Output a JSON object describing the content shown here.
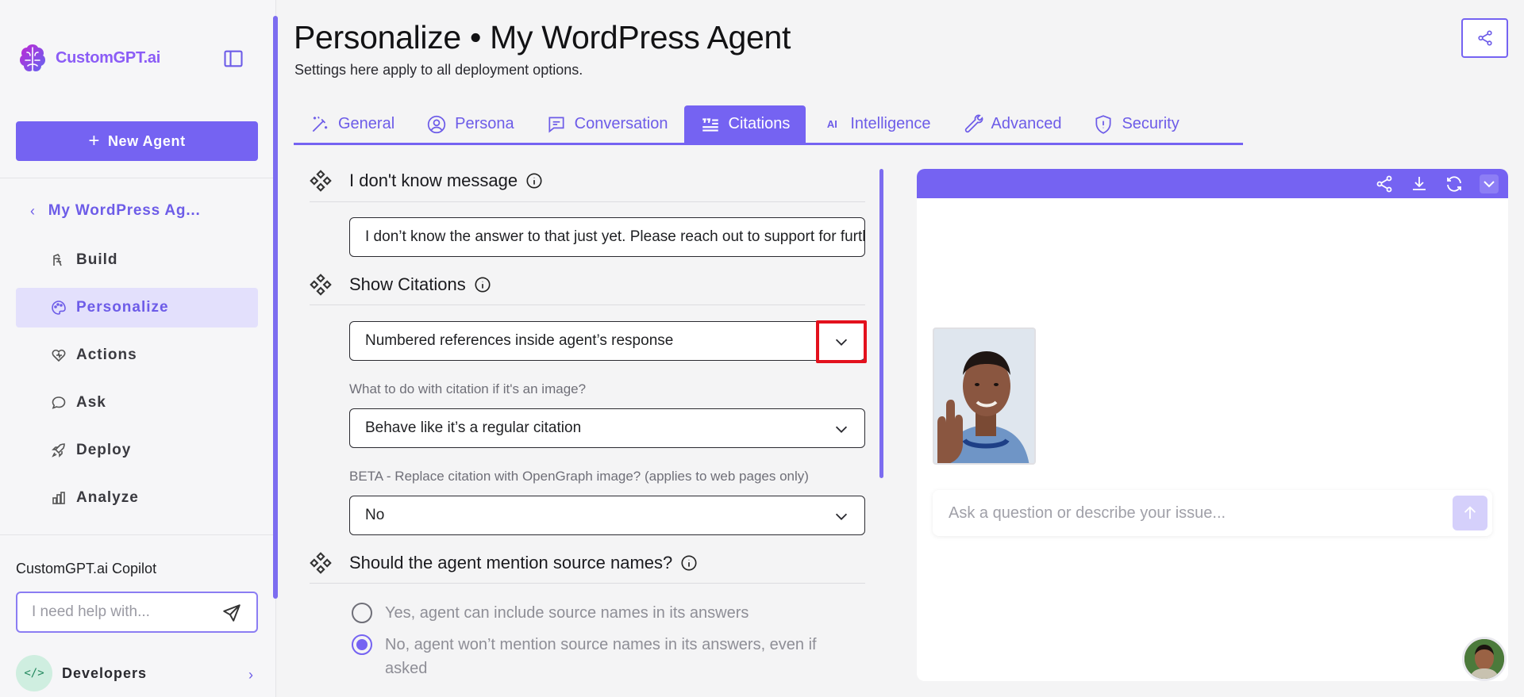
{
  "brand": {
    "name": "CustomGPT.ai",
    "accent": "#7563f2",
    "highlight": "#e3111d"
  },
  "sidebar": {
    "new_agent_label": "New Agent",
    "agent_name": "My WordPress Ag...",
    "items": [
      {
        "label": "Build",
        "icon": "build-icon"
      },
      {
        "label": "Personalize",
        "icon": "palette-icon",
        "active": true
      },
      {
        "label": "Actions",
        "icon": "actions-icon"
      },
      {
        "label": "Ask",
        "icon": "chat-icon"
      },
      {
        "label": "Deploy",
        "icon": "rocket-icon"
      },
      {
        "label": "Analyze",
        "icon": "chart-icon"
      }
    ],
    "copilot": {
      "title": "CustomGPT.ai Copilot",
      "placeholder": "I need help with..."
    },
    "developers_label": "Developers"
  },
  "header": {
    "title": "Personalize • My WordPress Agent",
    "subtitle": "Settings here apply to all deployment options."
  },
  "tabs": [
    {
      "label": "General",
      "icon": "magic-wand-icon"
    },
    {
      "label": "Persona",
      "icon": "user-circle-icon"
    },
    {
      "label": "Conversation",
      "icon": "message-icon"
    },
    {
      "label": "Citations",
      "icon": "quote-icon",
      "active": true
    },
    {
      "label": "Intelligence",
      "icon": "ai-icon"
    },
    {
      "label": "Advanced",
      "icon": "wrench-icon"
    },
    {
      "label": "Security",
      "icon": "shield-icon"
    }
  ],
  "form": {
    "idk": {
      "title": "I don't know message",
      "value": "I don’t know the answer to that just yet. Please reach out to support for further help."
    },
    "show_citations": {
      "title": "Show Citations",
      "selected": "Numbered references inside agent’s response"
    },
    "image_citation": {
      "label": "What to do with citation if it's an image?",
      "selected": "Behave like it’s a regular citation"
    },
    "opengraph": {
      "label": "BETA - Replace citation with OpenGraph image? (applies to web pages only)",
      "selected": "No"
    },
    "source_names": {
      "title": "Should the agent mention source names?",
      "options": [
        {
          "label": "Yes, agent can include source names in its answers",
          "selected": false
        },
        {
          "label": "No, agent won’t mention source names in its answers, even if asked",
          "selected": true
        }
      ]
    }
  },
  "preview": {
    "ask_placeholder": "Ask a question or describe your issue..."
  }
}
